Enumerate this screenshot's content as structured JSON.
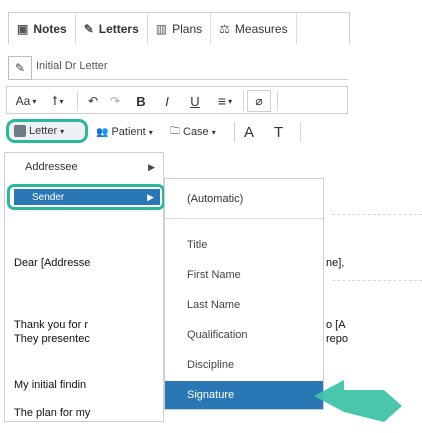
{
  "tabs": [
    {
      "icon": "notes-icon",
      "label": "Notes",
      "active": true
    },
    {
      "icon": "letters-icon",
      "label": "Letters",
      "active": true
    },
    {
      "icon": "plans-icon",
      "label": "Plans",
      "active": false
    },
    {
      "icon": "measures-icon",
      "label": "Measures",
      "active": false
    }
  ],
  "title": {
    "icon": "pencil-icon",
    "value": "Initial Dr Letter"
  },
  "toolbar1": {
    "font_label": "Aa",
    "underline_label": "U",
    "bold_label": "B",
    "italic_label": "I",
    "align_label": "≡",
    "undo_label": "↶",
    "redo_label": "↷"
  },
  "toolbar2": {
    "letter_label": "Letter",
    "patient_label": "Patient",
    "case_label": "Case",
    "font_size_label": "A",
    "clear_format_label": "T"
  },
  "menu_level1": {
    "items": [
      {
        "label": "Addressee",
        "has_submenu": true
      },
      {
        "label": "Sender",
        "has_submenu": true,
        "selected": true
      }
    ]
  },
  "menu_level2": {
    "top_item": "(Automatic)",
    "items": [
      {
        "label": "Title"
      },
      {
        "label": "First Name"
      },
      {
        "label": "Last Name"
      },
      {
        "label": "Qualification"
      },
      {
        "label": "Discipline"
      },
      {
        "label": "Signature",
        "selected": true
      }
    ]
  },
  "document": {
    "line1": "Dear [Addresse",
    "line2": "Thank you for r",
    "line3": "They presentec",
    "line4": "My initial findin",
    "line5": "The plan for my",
    "right1": "ne],",
    "right2": "o [A",
    "right3": "repo"
  },
  "colors": {
    "highlight": "#2bb79d",
    "selection": "#2a77b6"
  }
}
